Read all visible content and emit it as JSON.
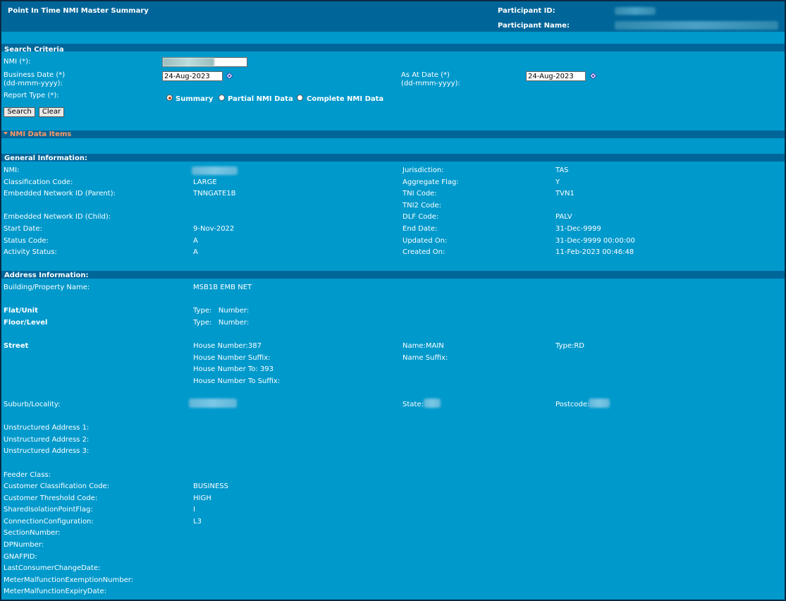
{
  "header": {
    "title": "Point In Time NMI Master Summary",
    "participant_id_label": "Participant ID:",
    "participant_name_label": "Participant Name:"
  },
  "search": {
    "section_title": "Search Criteria",
    "nmi_label": "NMI (*):",
    "business_date_label": "Business Date (*)",
    "business_date_format": "(dd-mmm-yyyy):",
    "business_date_value": "24-Aug-2023",
    "as_at_date_label": "As At Date (*)",
    "as_at_date_format": "(dd-mmm-yyyy):",
    "as_at_date_value": "24-Aug-2023",
    "report_type_label": "Report Type (*):",
    "report_types": [
      "Summary",
      "Partial NMI Data",
      "Complete NMI Data"
    ],
    "selected_report_type": "Summary",
    "search_button": "Search",
    "clear_button": "Clear"
  },
  "nmi_data_items": {
    "label": "NMI Data Items"
  },
  "general": {
    "section_title": "General Information:",
    "nmi_label": "NMI:",
    "classification_code_label": "Classification Code:",
    "classification_code": "LARGE",
    "embedded_parent_label": "Embedded Network ID (Parent):",
    "embedded_parent": "TNNGATE1B",
    "embedded_child_label": "Embedded Network ID (Child):",
    "start_date_label": "Start Date:",
    "start_date": "9-Nov-2022",
    "status_code_label": "Status Code:",
    "status_code": "A",
    "activity_status_label": "Activity Status:",
    "activity_status": "A",
    "jurisdiction_label": "Jurisdiction:",
    "jurisdiction": "TAS",
    "aggregate_flag_label": "Aggregate Flag:",
    "aggregate_flag": "Y",
    "tni_code_label": "TNI Code:",
    "tni_code": "TVN1",
    "tni2_code_label": "TNI2 Code:",
    "dlf_code_label": "DLF Code:",
    "dlf_code": "PALV",
    "end_date_label": "End Date:",
    "end_date": "31-Dec-9999",
    "updated_on_label": "Updated On:",
    "updated_on": "31-Dec-9999 00:00:00",
    "created_on_label": "Created On:",
    "created_on": "11-Feb-2023 00:46:48"
  },
  "address": {
    "section_title": "Address Information:",
    "building_label": "Building/Property Name:",
    "building": "MSB1B EMB NET",
    "flat_label": "Flat/Unit",
    "flat_value": "Type:   Number:",
    "floor_label": "Floor/Level",
    "floor_value": "Type:   Number:",
    "street_label": "Street",
    "house_number": "House Number:387",
    "house_number_suffix": "House Number Suffix:",
    "house_number_to": "House Number To: 393",
    "house_number_to_suffix": "House Number To Suffix:",
    "street_name": "Name:MAIN",
    "name_suffix": "Name Suffix:",
    "street_type": "Type:RD",
    "suburb_label": "Suburb/Locality:",
    "state_label": "State:",
    "postcode_label": "Postcode:",
    "unstructured_1": "Unstructured Address 1:",
    "unstructured_2": "Unstructured Address 2:",
    "unstructured_3": "Unstructured Address 3:",
    "feeder_class_label": "Feeder Class:",
    "customer_class_label": "Customer Classification Code:",
    "customer_class": "BUSINESS",
    "customer_threshold_label": "Customer Threshold Code:",
    "customer_threshold": "HIGH",
    "shared_isolation_label": "SharedIsolationPointFlag:",
    "shared_isolation": "I",
    "connection_config_label": "ConnectionConfiguration:",
    "connection_config": "L3",
    "section_number_label": "SectionNumber:",
    "dp_number_label": "DPNumber:",
    "gnafpid_label": "GNAFPID:",
    "last_consumer_change_label": "LastConsumerChangeDate:",
    "meter_exemption_label": "MeterMalfunctionExemptionNumber:",
    "meter_expiry_label": "MeterMalfunctionExpiryDate:"
  },
  "colors": {
    "background": "#0099cc",
    "band": "#006699",
    "accent": "#ff9966"
  }
}
